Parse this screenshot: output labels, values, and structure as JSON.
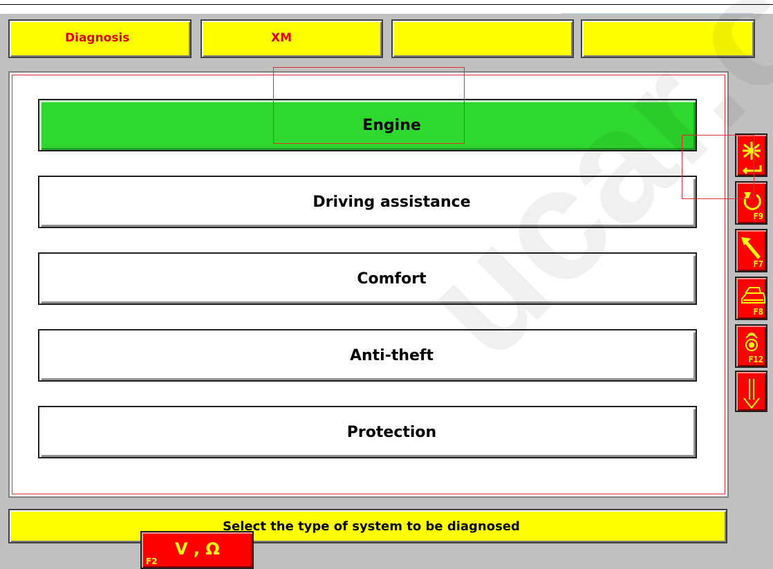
{
  "header": {
    "tabs": [
      {
        "label": "Diagnosis"
      },
      {
        "label": "XM"
      },
      {
        "label": ""
      },
      {
        "label": ""
      }
    ]
  },
  "menu": {
    "items": [
      {
        "label": "Engine",
        "selected": true
      },
      {
        "label": "Driving assistance",
        "selected": false
      },
      {
        "label": "Comfort",
        "selected": false
      },
      {
        "label": "Anti-theft",
        "selected": false
      },
      {
        "label": "Protection",
        "selected": false
      }
    ]
  },
  "status": {
    "message": "Select the type of system to be diagnosed"
  },
  "side_buttons": [
    {
      "icon": "asterisk-enter-icon",
      "key": ""
    },
    {
      "icon": "undo-arrow-icon",
      "key": "F9"
    },
    {
      "icon": "arrow-up-left-icon",
      "key": "F7"
    },
    {
      "icon": "print-icon",
      "key": "F8"
    },
    {
      "icon": "antenna-icon",
      "key": "F12"
    },
    {
      "icon": "arrow-down-icon",
      "key": ""
    }
  ],
  "multimeter": {
    "fkey": "F2",
    "label": "V , Ω"
  },
  "colors": {
    "header_bg": "#ffff00",
    "header_text": "#e00000",
    "selected": "#2ed82e",
    "side_button": "#ff0000",
    "icon": "#ffff00"
  }
}
